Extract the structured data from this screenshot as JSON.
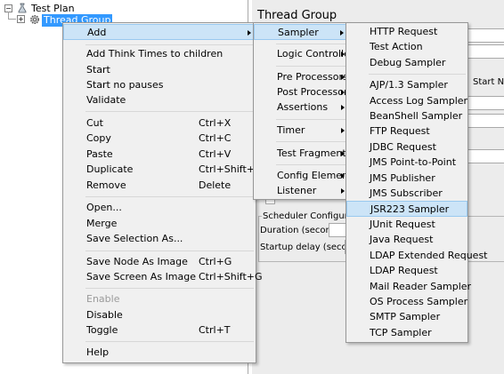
{
  "tree": {
    "root_label": "Test Plan",
    "child_label": "Thread Group"
  },
  "right_panel": {
    "title": "Thread Group",
    "start_next_label": "Start Nex",
    "scheduler_title": "Scheduler Configuration",
    "duration_label": "Duration (seconds)",
    "startup_delay_label": "Startup delay (seconds)"
  },
  "context_menu": {
    "items": [
      {
        "label": "Add",
        "has_submenu": true
      },
      {
        "label": "Add Think Times to children"
      },
      {
        "label": "Start"
      },
      {
        "label": "Start no pauses"
      },
      {
        "label": "Validate"
      },
      {
        "label": "Cut",
        "shortcut": "Ctrl+X"
      },
      {
        "label": "Copy",
        "shortcut": "Ctrl+C"
      },
      {
        "label": "Paste",
        "shortcut": "Ctrl+V"
      },
      {
        "label": "Duplicate",
        "shortcut": "Ctrl+Shift+C"
      },
      {
        "label": "Remove",
        "shortcut": "Delete"
      },
      {
        "label": "Open..."
      },
      {
        "label": "Merge"
      },
      {
        "label": "Save Selection As..."
      },
      {
        "label": "Save Node As Image",
        "shortcut": "Ctrl+G"
      },
      {
        "label": "Save Screen As Image",
        "shortcut": "Ctrl+Shift+G"
      },
      {
        "label": "Enable",
        "disabled": true
      },
      {
        "label": "Disable"
      },
      {
        "label": "Toggle",
        "shortcut": "Ctrl+T"
      },
      {
        "label": "Help"
      }
    ]
  },
  "add_submenu": {
    "items": [
      {
        "label": "Sampler",
        "has_submenu": true
      },
      {
        "label": "Logic Controller",
        "has_submenu": true
      },
      {
        "label": "Pre Processors",
        "has_submenu": true
      },
      {
        "label": "Post Processors",
        "has_submenu": true
      },
      {
        "label": "Assertions",
        "has_submenu": true
      },
      {
        "label": "Timer",
        "has_submenu": true
      },
      {
        "label": "Test Fragment",
        "has_submenu": true
      },
      {
        "label": "Config Element",
        "has_submenu": true
      },
      {
        "label": "Listener",
        "has_submenu": true
      }
    ]
  },
  "sampler_submenu": {
    "items": [
      {
        "label": "HTTP Request"
      },
      {
        "label": "Test Action"
      },
      {
        "label": "Debug Sampler"
      },
      {
        "label": "AJP/1.3 Sampler"
      },
      {
        "label": "Access Log Sampler"
      },
      {
        "label": "BeanShell Sampler"
      },
      {
        "label": "FTP Request"
      },
      {
        "label": "JDBC Request"
      },
      {
        "label": "JMS Point-to-Point"
      },
      {
        "label": "JMS Publisher"
      },
      {
        "label": "JMS Subscriber"
      },
      {
        "label": "JSR223 Sampler",
        "highlighted": true
      },
      {
        "label": "JUnit Request"
      },
      {
        "label": "Java Request"
      },
      {
        "label": "LDAP Extended Request"
      },
      {
        "label": "LDAP Request"
      },
      {
        "label": "Mail Reader Sampler"
      },
      {
        "label": "OS Process Sampler"
      },
      {
        "label": "SMTP Sampler"
      },
      {
        "label": "TCP Sampler"
      }
    ]
  }
}
